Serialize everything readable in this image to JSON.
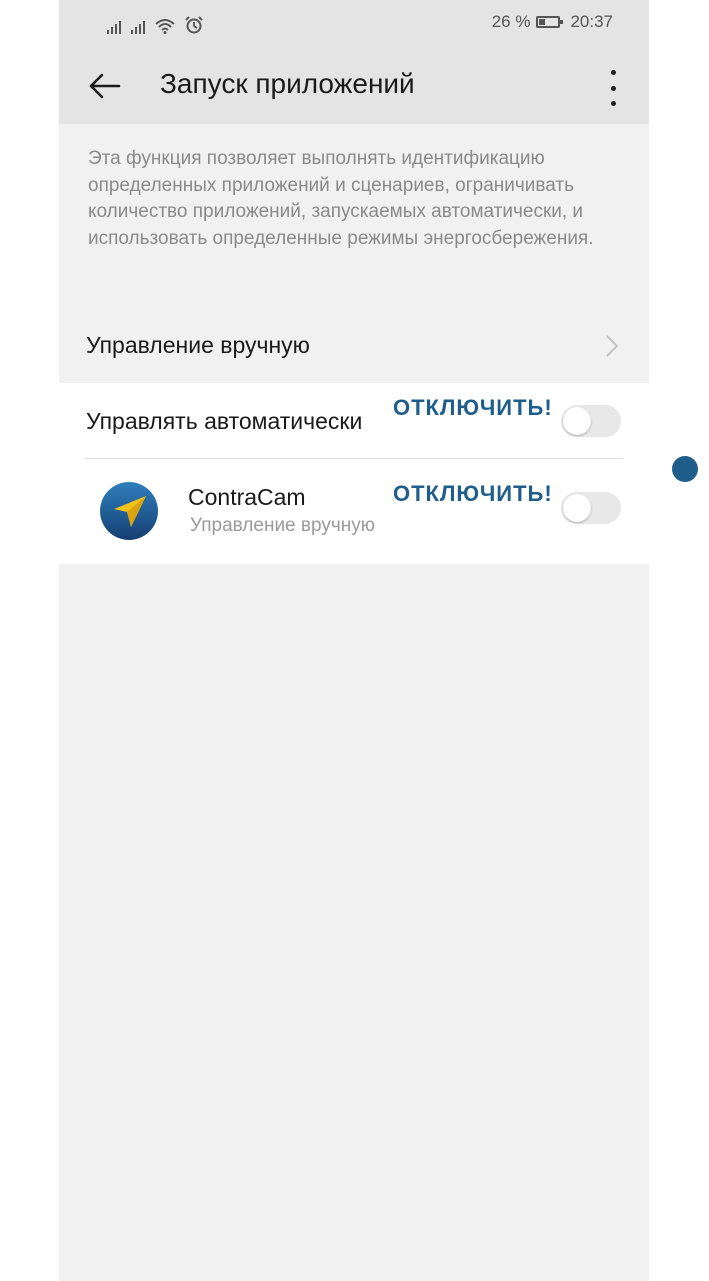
{
  "status_bar": {
    "battery_percent": "26 %",
    "time": "20:37",
    "icons": [
      "signal-icon",
      "signal-icon",
      "wifi-icon",
      "alarm-icon",
      "battery-icon"
    ]
  },
  "header": {
    "title": "Запуск приложений",
    "back_icon": "arrow-left-icon",
    "menu_icon": "more-vertical-icon"
  },
  "description": "Эта функция позволяет выполнять идентификацию определенных приложений и сценариев, ограничивать количество приложений, запускаемых автоматически, и использовать определенные режимы энергосбережения.",
  "manual_row": {
    "label": "Управление вручную",
    "icon": "chevron-right-icon"
  },
  "auto_row": {
    "label": "Управлять автоматически",
    "annotation": "ОТКЛЮЧИТЬ!",
    "toggle_on": false
  },
  "app_row": {
    "name": "ContraCam",
    "subtitle": "Управление вручную",
    "annotation": "ОТКЛЮЧИТЬ!",
    "toggle_on": false,
    "icon": "contracam-app-icon"
  },
  "colors": {
    "annotation": "#1f5e8a",
    "header_bg": "#e4e4e4",
    "page_bg": "#f1f1f1",
    "toggle_off": "#e8e8e8"
  }
}
